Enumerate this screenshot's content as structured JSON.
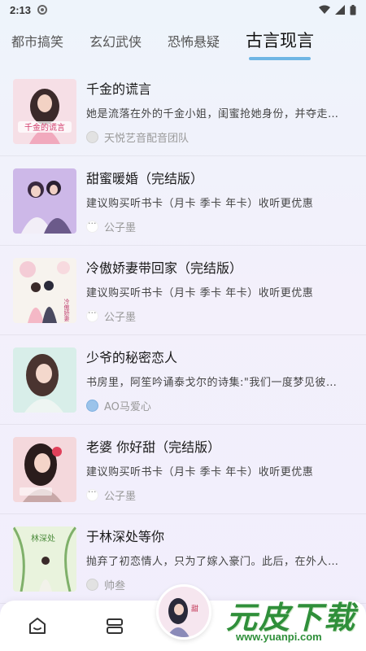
{
  "status_bar": {
    "time": "2:13"
  },
  "tabs": [
    {
      "label": "都市搞笑",
      "active": false
    },
    {
      "label": "玄幻武侠",
      "active": false
    },
    {
      "label": "恐怖悬疑",
      "active": false
    },
    {
      "label": "古言现言",
      "active": true
    }
  ],
  "books": [
    {
      "title": "千金的谎言",
      "desc": "她是流落在外的千金小姐，闺蜜抢她身份，并夺走…",
      "author": "天悦艺音配音团队",
      "avatar": "gray"
    },
    {
      "title": "甜蜜暖婚（完结版）",
      "desc": "建议购买听书卡（月卡  季卡  年卡）收听更优惠",
      "author": "公子墨",
      "avatar": "dots"
    },
    {
      "title": "冷傲娇妻带回家（完结版）",
      "desc": "建议购买听书卡（月卡  季卡  年卡）收听更优惠",
      "author": "公子墨",
      "avatar": "dots"
    },
    {
      "title": "少爷的秘密恋人",
      "desc": "书房里，阿笙吟诵泰戈尔的诗集:\"我们一度梦见彼…",
      "author": "AO马爱心",
      "avatar": "face"
    },
    {
      "title": "老婆 你好甜（完结版）",
      "desc": "建议购买听书卡（月卡  季卡  年卡）收听更优惠",
      "author": "公子墨",
      "avatar": "dots"
    },
    {
      "title": "于林深处等你",
      "desc": "抛弃了初恋情人，只为了嫁入豪门。此后，在外人…",
      "author": "帅叁",
      "avatar": "gray"
    }
  ],
  "watermark": {
    "main": "元皮下载",
    "url": "www.yuanpi.com"
  },
  "colors": {
    "accent": "#6fb5e4",
    "watermark": "#2f8f3a"
  }
}
